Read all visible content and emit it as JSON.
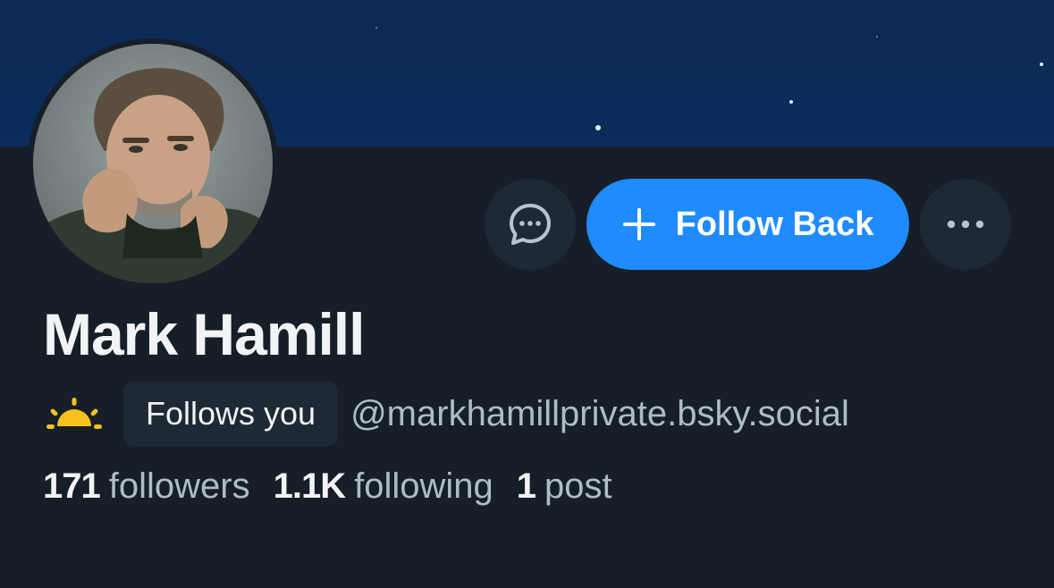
{
  "profile": {
    "display_name": "Mark Hamill",
    "follows_you_label": "Follows you",
    "handle": "@markhamillprivate.bsky.social",
    "status_icon": "sun-icon"
  },
  "actions": {
    "message_icon": "message-icon",
    "follow_label": "Follow Back",
    "follow_icon": "plus-icon",
    "more_icon": "more-icon"
  },
  "stats": {
    "followers_count": "171",
    "followers_label": "followers",
    "following_count": "1.1K",
    "following_label": "following",
    "posts_count": "1",
    "posts_label": "post"
  },
  "colors": {
    "accent": "#208bfe",
    "background": "#161e27",
    "banner": "#0b2c5c",
    "button_secondary": "#1e2935",
    "text_primary": "#f1f3f5",
    "text_secondary": "#aebbc9",
    "sun_icon": "#f7c21b"
  }
}
